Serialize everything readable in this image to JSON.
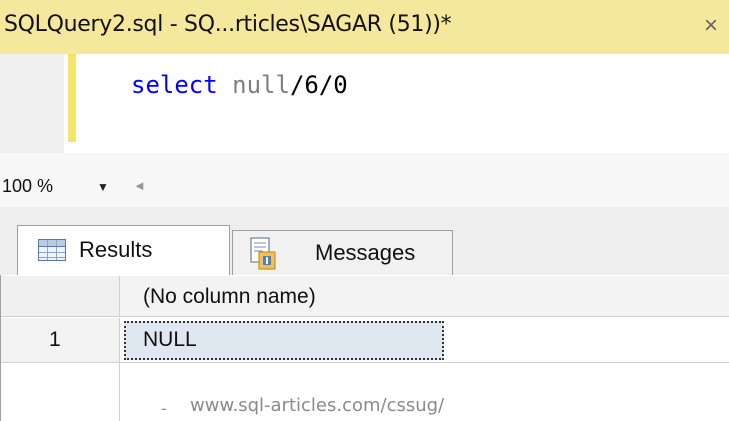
{
  "document_tab": {
    "title": "SQLQuery2.sql - SQ...rticles\\SAGAR (51))*",
    "close_glyph": "×"
  },
  "editor": {
    "code_keyword": "select",
    "code_null": "null",
    "code_rest": "/6/0"
  },
  "zoom": {
    "value": "100 %",
    "dropdown_glyph": "▼",
    "scroll_glyph": "◄"
  },
  "results_tabs": [
    {
      "label": "Results",
      "icon": "grid-icon",
      "active": true
    },
    {
      "label": "Messages",
      "icon": "messages-icon",
      "active": false
    }
  ],
  "grid": {
    "columns": [
      "(No column name)"
    ],
    "rows": [
      {
        "row_number": "1",
        "values": [
          "NULL"
        ]
      }
    ]
  },
  "watermark": {
    "dash": "-",
    "text": "www.sql-articles.com/cssug/"
  },
  "colors": {
    "tab_strip": "#f5e79b",
    "change_bar": "#f3e56a",
    "keyword": "#0000ff",
    "null_keyword": "#808080",
    "selected_cell": "#dfe7f0"
  }
}
